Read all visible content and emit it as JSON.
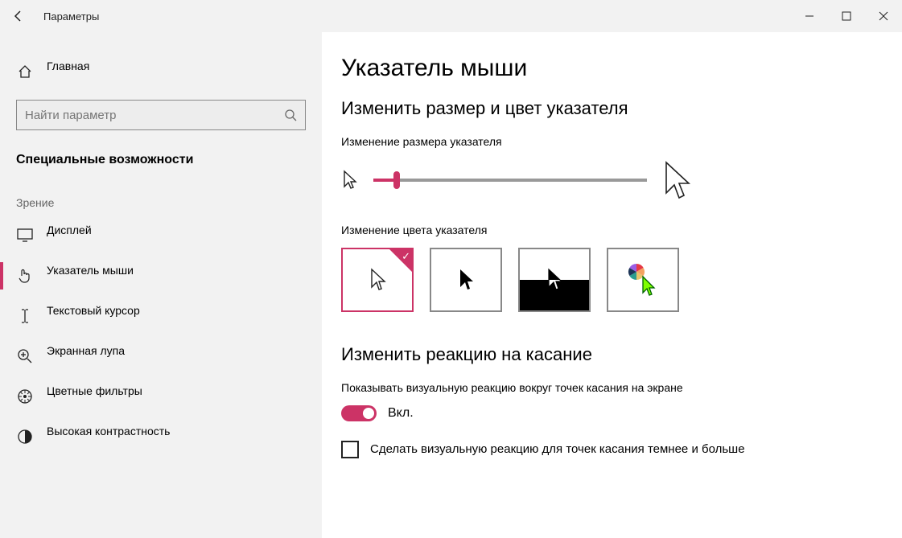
{
  "titlebar": {
    "title": "Параметры"
  },
  "sidebar": {
    "home": "Главная",
    "search_placeholder": "Найти параметр",
    "category": "Специальные возможности",
    "group": "Зрение",
    "items": [
      {
        "label": "Дисплей"
      },
      {
        "label": "Указатель мыши",
        "active": true
      },
      {
        "label": "Текстовый курсор"
      },
      {
        "label": "Экранная лупа"
      },
      {
        "label": "Цветные фильтры"
      },
      {
        "label": "Высокая контрастность"
      }
    ]
  },
  "main": {
    "heading": "Указатель мыши",
    "section1_heading": "Изменить размер и цвет указателя",
    "size_label": "Изменение размера указателя",
    "color_label": "Изменение цвета указателя",
    "color_options": [
      {
        "name": "white",
        "selected": true
      },
      {
        "name": "black"
      },
      {
        "name": "inverted"
      },
      {
        "name": "custom"
      }
    ],
    "section2_heading": "Изменить реакцию на касание",
    "touch_label": "Показывать визуальную реакцию вокруг точек касания на экране",
    "toggle_text": "Вкл.",
    "toggle_state": "on",
    "checkbox_label": "Сделать визуальную реакцию для точек касания темнее и больше",
    "checkbox_checked": false
  },
  "colors": {
    "accent": "#cc3366"
  }
}
